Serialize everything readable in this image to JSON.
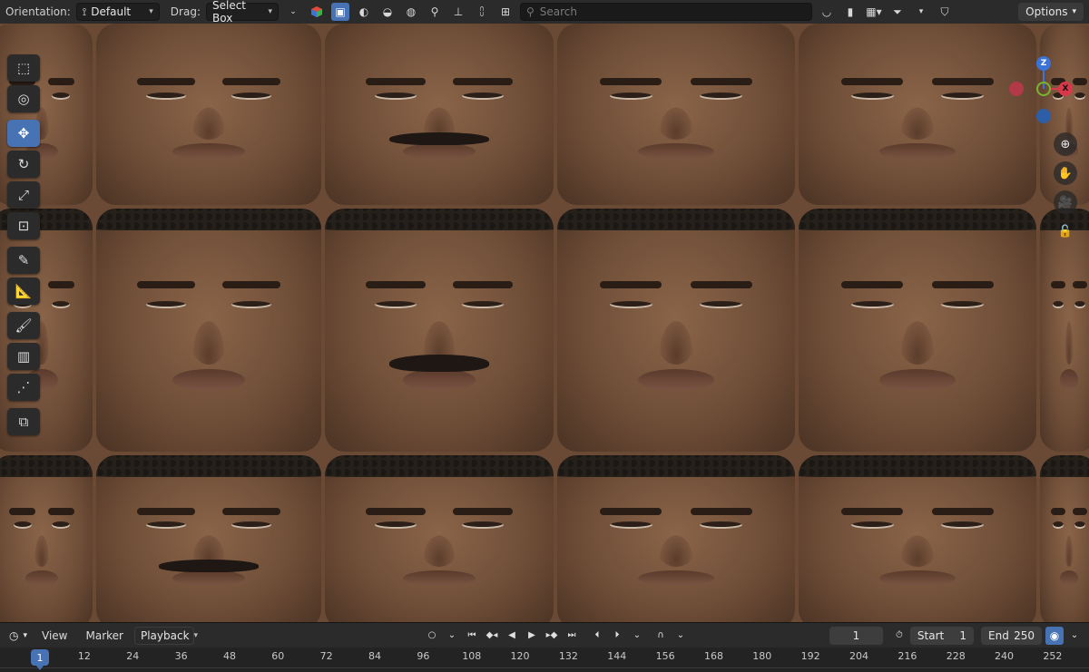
{
  "header": {
    "orientation_label": "Orientation:",
    "orientation_value": "Default",
    "drag_label": "Drag:",
    "drag_value": "Select Box",
    "search_placeholder": "Search",
    "options_label": "Options"
  },
  "viewport": {
    "faces_count": 18,
    "colors": {
      "skin": "#7a5640",
      "hair": "#26201b",
      "background": "#6b4a35"
    }
  },
  "tools": [
    "select-box-icon",
    "cursor-icon",
    "move-icon",
    "rotate-icon",
    "scale-icon",
    "transform-icon",
    "annotate-icon",
    "measure-icon",
    "paint-brush-icon",
    "uv-grid-icon",
    "shear-icon",
    "add-cube-icon"
  ],
  "gizmo": {
    "z": "Z",
    "x": "X",
    "colors": {
      "z": "#3b74d6",
      "x": "#d9384a",
      "y": "#77b52c"
    }
  },
  "timeline": {
    "menu": {
      "view": "View",
      "marker": "Marker",
      "playback": "Playback"
    },
    "current_frame": "1",
    "start_label": "Start",
    "start_value": "1",
    "end_label": "End",
    "end_value": "250",
    "ruler_marks": [
      "12",
      "24",
      "36",
      "48",
      "60",
      "72",
      "84",
      "96",
      "108",
      "120",
      "132",
      "144",
      "156",
      "168",
      "180",
      "192",
      "204",
      "216",
      "228",
      "240",
      "252"
    ],
    "playhead": "1"
  },
  "accent_color": "#4772b3"
}
